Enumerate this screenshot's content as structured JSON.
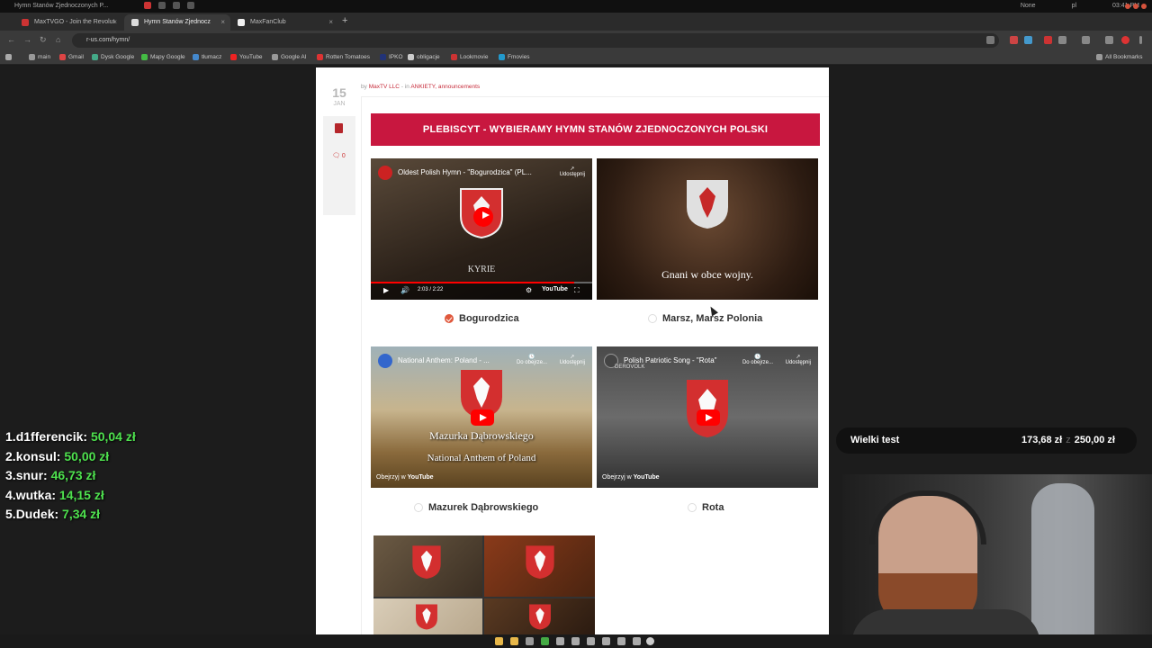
{
  "window": {
    "title": "Hymn Stanów Zjednoczonych P...",
    "status_right": [
      "None",
      "pl",
      "03:41 PM"
    ]
  },
  "tabs": [
    {
      "label": "MaxTVGO - Join the Revolut",
      "active": false
    },
    {
      "label": "Hymn Stanów Zjednocz",
      "active": true
    },
    {
      "label": "MaxFanClub",
      "active": false
    }
  ],
  "address_bar": {
    "url": "r-us.com/hymn/"
  },
  "bookmarks": {
    "items": [
      "main",
      "Gmail",
      "Dysk Google",
      "Mapy Google",
      "tłumacz",
      "YouTube",
      "Google AI",
      "Rotten Tomatoes",
      "IPKO",
      "obligacje",
      "Lookmovie",
      "Fmovies"
    ],
    "all_label": "All Bookmarks"
  },
  "post": {
    "day": "15",
    "month": "JAN",
    "comment_count": "0",
    "meta_prefix": "by",
    "author": "MaxTV LLC",
    "meta_in": "- in",
    "categories": "ANKIETY, announcements",
    "banner": "PLEBISCYT - WYBIERAMY HYMN STANÓW ZJEDNOCZONYCH POLSKI"
  },
  "videos": [
    {
      "title": "Oldest Polish Hymn - \"Bogurodzica\" (PL...",
      "overlay": "KYRIE",
      "time": "2:03 / 2:22",
      "share": "Udostępnij",
      "brand": "YouTube",
      "option": "Bogurodzica",
      "selected": true
    },
    {
      "title": "",
      "overlay": "Gnani w obce wojny.",
      "option": "Marsz, Marsz Polonia",
      "selected": false
    },
    {
      "title": "National Anthem: Poland - ...",
      "overlay": "Mazurka Dąbrowskiego",
      "overlay2": "National Anthem of Poland",
      "watch_later": "Do obejrze...",
      "share": "Udostępnij",
      "watch_on": "Obejrzyj w",
      "brand": "YouTube",
      "option": "Mazurek Dąbrowskiego",
      "selected": false
    },
    {
      "title": "Polish Patriotic Song - \"Rota\"",
      "channel": "DEROVOLK",
      "watch_later": "Do obejrze...",
      "share": "Udostępnij",
      "watch_on": "Obejrzyj w",
      "brand": "YouTube",
      "option": "Rota",
      "selected": false
    }
  ],
  "leaderboard": [
    {
      "rank": "1.",
      "name": "d1fferencik:",
      "amount": "50,04 zł"
    },
    {
      "rank": "2.",
      "name": "konsul:",
      "amount": "50,00 zł"
    },
    {
      "rank": "3.",
      "name": "snur:",
      "amount": "46,73 zł"
    },
    {
      "rank": "4.",
      "name": "wutka:",
      "amount": "14,15 zł"
    },
    {
      "rank": "5.",
      "name": "Dudek:",
      "amount": "7,34 zł"
    }
  ],
  "goal": {
    "name": "Wielki test",
    "current": "173,68 zł",
    "target": "250,00 zł"
  },
  "colors": {
    "banner": "#c8173f",
    "accent": "#e0593d",
    "leader_amount": "#4ee14e"
  }
}
